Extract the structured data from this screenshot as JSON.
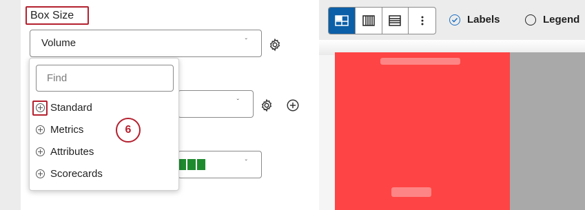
{
  "box_size": {
    "heading": "Box Size"
  },
  "volume_select": {
    "value": "Volume"
  },
  "find": {
    "placeholder": "Find"
  },
  "menu": {
    "items": [
      {
        "label": "Standard"
      },
      {
        "label": "Metrics"
      },
      {
        "label": "Attributes"
      },
      {
        "label": "Scorecards"
      }
    ]
  },
  "step_badge": "6",
  "toolbar": {
    "buttons": [
      "grid-layout-icon",
      "vertical-bars-icon",
      "horizontal-rows-icon",
      "more-options-icon"
    ]
  },
  "toggles": {
    "labels": "Labels",
    "legend": "Legend"
  },
  "colors": {
    "accent": "#0b5fa8",
    "highlight": "#b3202e",
    "tile_red": "#fe4444",
    "tile_gray": "#a9a9a9",
    "green_swatch": "#1e8a2e"
  }
}
